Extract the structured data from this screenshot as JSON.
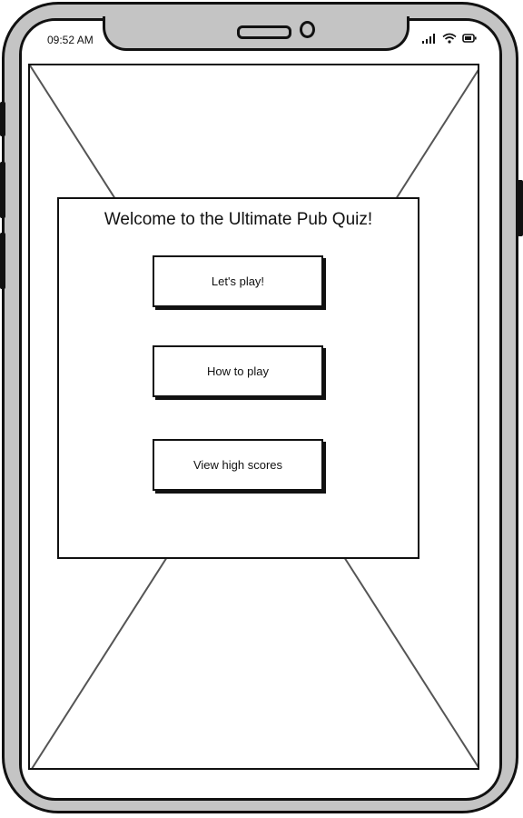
{
  "status_bar": {
    "time": "09:52 AM",
    "icons": [
      "signal-icon",
      "wifi-icon",
      "battery-icon"
    ]
  },
  "modal": {
    "title": "Welcome to the Ultimate Pub Quiz!",
    "buttons": [
      {
        "label": "Let's play!"
      },
      {
        "label": "How to play"
      },
      {
        "label": "View high scores"
      }
    ]
  },
  "colors": {
    "device_frame": "#c4c4c4",
    "ink": "#111111",
    "screen": "#ffffff"
  }
}
